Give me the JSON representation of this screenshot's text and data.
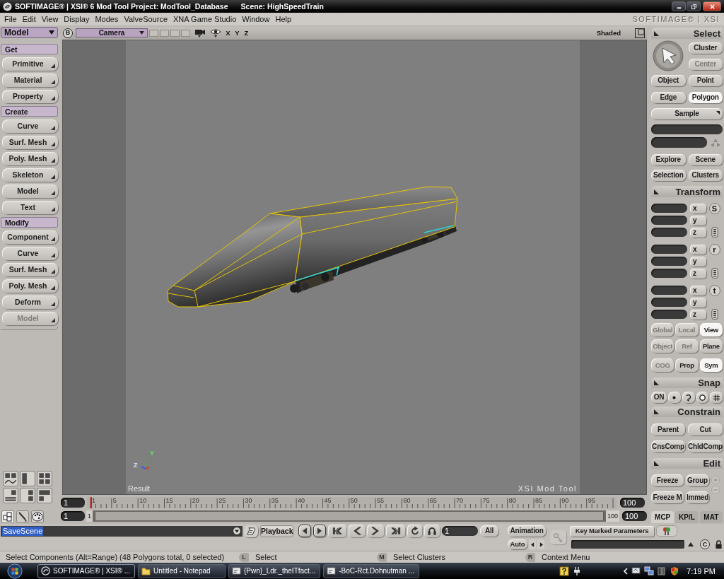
{
  "window": {
    "title": "SOFTIMAGE® | XSI® 6 Mod Tool Project: ModTool_Database",
    "scene": "Scene: HighSpeedTrain"
  },
  "menu": {
    "items": [
      "File",
      "Edit",
      "View",
      "Display",
      "Modes",
      "ValveSource",
      "XNA Game Studio",
      "Window",
      "Help"
    ],
    "brand": "SOFTIMAGE® | XSI"
  },
  "toolbar": {
    "mode": "Model",
    "sections": [
      {
        "title": "Get",
        "buttons": [
          {
            "label": "Primitive",
            "disabled": false
          },
          {
            "label": "Material",
            "disabled": false
          },
          {
            "label": "Property",
            "disabled": false
          }
        ]
      },
      {
        "title": "Create",
        "buttons": [
          {
            "label": "Curve",
            "disabled": false
          },
          {
            "label": "Surf. Mesh",
            "disabled": false
          },
          {
            "label": "Poly. Mesh",
            "disabled": false
          },
          {
            "label": "Skeleton",
            "disabled": false
          },
          {
            "label": "Model",
            "disabled": false
          },
          {
            "label": "Text",
            "disabled": false
          }
        ]
      },
      {
        "title": "Modify",
        "buttons": [
          {
            "label": "Component",
            "disabled": false
          },
          {
            "label": "Curve",
            "disabled": false
          },
          {
            "label": "Surf. Mesh",
            "disabled": false
          },
          {
            "label": "Poly. Mesh",
            "disabled": false
          },
          {
            "label": "Deform",
            "disabled": false
          },
          {
            "label": "Model",
            "disabled": true
          }
        ]
      }
    ]
  },
  "viewport": {
    "pane": "B",
    "camera": "Camera",
    "axes": [
      "X",
      "Y",
      "Z"
    ],
    "shading": "Shaded",
    "gizmo": [
      "Y",
      "Z"
    ],
    "label": "Result",
    "product": "XSI Mod Tool"
  },
  "timeline": {
    "start": "1",
    "ticks": [
      "1",
      "5",
      "10",
      "15",
      "20",
      "25",
      "30",
      "35",
      "40",
      "45",
      "50",
      "55",
      "60",
      "65",
      "70",
      "75",
      "80",
      "85",
      "90",
      "95"
    ],
    "level": 0,
    "end": "100",
    "range": {
      "in": "1",
      "start": "1",
      "level": 1,
      "end": "100",
      "out": "100"
    }
  },
  "select": {
    "title": "Select",
    "buttons": [
      {
        "label": "Cluster",
        "disabled": false,
        "selected": false
      },
      {
        "label": "Center",
        "disabled": true,
        "selected": false
      },
      {
        "label": "Object",
        "disabled": false,
        "selected": false
      },
      {
        "label": "Point",
        "disabled": false,
        "selected": false
      },
      {
        "label": "Edge",
        "disabled": false,
        "selected": false
      },
      {
        "label": "Polygon",
        "disabled": false,
        "selected": true
      }
    ],
    "sample": "Sample",
    "views": [
      "Explore",
      "Scene",
      "Selection",
      "Clusters"
    ]
  },
  "transform": {
    "title": "Transform",
    "groups": [
      {
        "letter": "S",
        "axes": [
          "x",
          "y",
          "z"
        ]
      },
      {
        "letter": "r",
        "axes": [
          "x",
          "y",
          "z"
        ]
      },
      {
        "letter": "t",
        "axes": [
          "x",
          "y",
          "z"
        ]
      }
    ],
    "mode_rows": [
      {
        "buttons": [
          {
            "label": "Global",
            "disabled": true,
            "selected": false
          },
          {
            "label": "Local",
            "disabled": true,
            "selected": false
          },
          {
            "label": "View",
            "disabled": false,
            "selected": true
          }
        ]
      },
      {
        "buttons": [
          {
            "label": "Object",
            "disabled": true,
            "selected": false
          },
          {
            "label": "Ref",
            "disabled": true,
            "selected": false
          },
          {
            "label": "Plane",
            "disabled": false,
            "selected": false
          }
        ]
      },
      {
        "buttons": [
          {
            "label": "COG",
            "disabled": true,
            "selected": false
          },
          {
            "label": "Prop",
            "disabled": false,
            "selected": false
          },
          {
            "label": "Sym",
            "disabled": false,
            "selected": true
          }
        ]
      }
    ]
  },
  "snap": {
    "title": "Snap",
    "on": "ON",
    "toggles": [
      {
        "kind": "point"
      },
      {
        "kind": "curve"
      },
      {
        "kind": "circle"
      },
      {
        "kind": "grid"
      }
    ]
  },
  "constrain": {
    "title": "Constrain",
    "buttons": [
      "Parent",
      "Cut",
      "CnsComp",
      "ChldComp"
    ]
  },
  "edit": {
    "title": "Edit",
    "buttons": [
      "Freeze",
      "Group",
      "Freeze M",
      "Immed"
    ]
  },
  "panel_tabs": [
    {
      "label": "MCP",
      "selected": true
    },
    {
      "label": "KP/L",
      "selected": false
    },
    {
      "label": "MAT",
      "selected": false
    }
  ],
  "command": {
    "value": "SaveScene",
    "highlighted": true
  },
  "playback": {
    "label": "Playback",
    "frame": "1",
    "all": "All",
    "animation": "Animation",
    "auto": "Auto"
  },
  "keys": {
    "label": "Key Marked Parameters",
    "clear": "C"
  },
  "status": {
    "message": "Select Components (Alt=Range) (48 Polygons total, 0 selected)",
    "mouse": [
      {
        "button": "L",
        "action": "Select"
      },
      {
        "button": "M",
        "action": "Select Clusters"
      },
      {
        "button": "R",
        "action": "Context Menu"
      }
    ]
  },
  "taskbar": {
    "tasks": [
      {
        "kind": "app",
        "label": "SOFTIMAGE® | XSI® ...",
        "selected": true
      },
      {
        "kind": "notepad",
        "label": "Untitled - Notepad",
        "selected": false
      },
      {
        "kind": "chat",
        "label": "{Pwn}_Ldr._theITfact...",
        "selected": false
      },
      {
        "kind": "chat",
        "label": "-BoC-Rct.Dohnutman ...",
        "selected": false
      }
    ],
    "clock": "7:19 PM"
  }
}
